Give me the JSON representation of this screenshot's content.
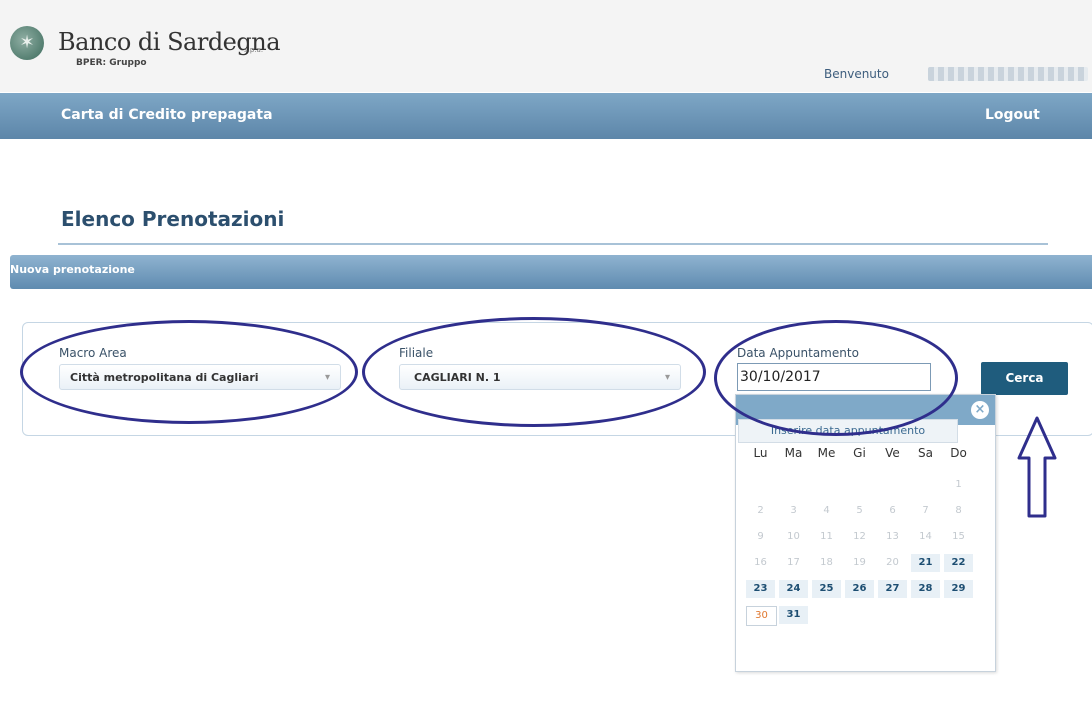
{
  "header": {
    "brand": "Banco di Sardegna",
    "brand_suffix": "s.p.a.",
    "group": "BPER: Gruppo",
    "welcome": "Benvenuto"
  },
  "nav": {
    "title": "Carta di Credito prepagata",
    "logout": "Logout"
  },
  "page": {
    "title": "Elenco Prenotazioni",
    "section": "Nuova prenotazione"
  },
  "form": {
    "macro_area_label": "Macro Area",
    "macro_area_value": "Città metropolitana di Cagliari",
    "filiale_label": "Filiale",
    "filiale_value": "CAGLIARI N. 1",
    "data_label": "Data Appuntamento",
    "data_value": "30/10/2017",
    "search_button": "Cerca"
  },
  "datepicker": {
    "tooltip": "Inserire data appuntamento",
    "weekdays": [
      "Lu",
      "Ma",
      "Me",
      "Gi",
      "Ve",
      "Sa",
      "Do"
    ],
    "days": [
      {
        "d": "1",
        "s": "off"
      },
      {
        "d": "2",
        "s": "off"
      },
      {
        "d": "3",
        "s": "off"
      },
      {
        "d": "4",
        "s": "off"
      },
      {
        "d": "5",
        "s": "off"
      },
      {
        "d": "6",
        "s": "off"
      },
      {
        "d": "7",
        "s": "off"
      },
      {
        "d": "8",
        "s": "off"
      },
      {
        "d": "9",
        "s": "off"
      },
      {
        "d": "10",
        "s": "off"
      },
      {
        "d": "11",
        "s": "off"
      },
      {
        "d": "12",
        "s": "off"
      },
      {
        "d": "13",
        "s": "off"
      },
      {
        "d": "14",
        "s": "off"
      },
      {
        "d": "15",
        "s": "off"
      },
      {
        "d": "16",
        "s": "off"
      },
      {
        "d": "17",
        "s": "off"
      },
      {
        "d": "18",
        "s": "off"
      },
      {
        "d": "19",
        "s": "off"
      },
      {
        "d": "20",
        "s": "off"
      },
      {
        "d": "21",
        "s": "on"
      },
      {
        "d": "22",
        "s": "on"
      },
      {
        "d": "23",
        "s": "on"
      },
      {
        "d": "24",
        "s": "on"
      },
      {
        "d": "25",
        "s": "on"
      },
      {
        "d": "26",
        "s": "on"
      },
      {
        "d": "27",
        "s": "on"
      },
      {
        "d": "28",
        "s": "on"
      },
      {
        "d": "29",
        "s": "on"
      },
      {
        "d": "30",
        "s": "today"
      },
      {
        "d": "31",
        "s": "on"
      }
    ]
  },
  "colors": {
    "nav": "#5d86a9",
    "section": "#5f8bb0",
    "button": "#1f5c7d",
    "annotation": "#2f2e8c"
  }
}
